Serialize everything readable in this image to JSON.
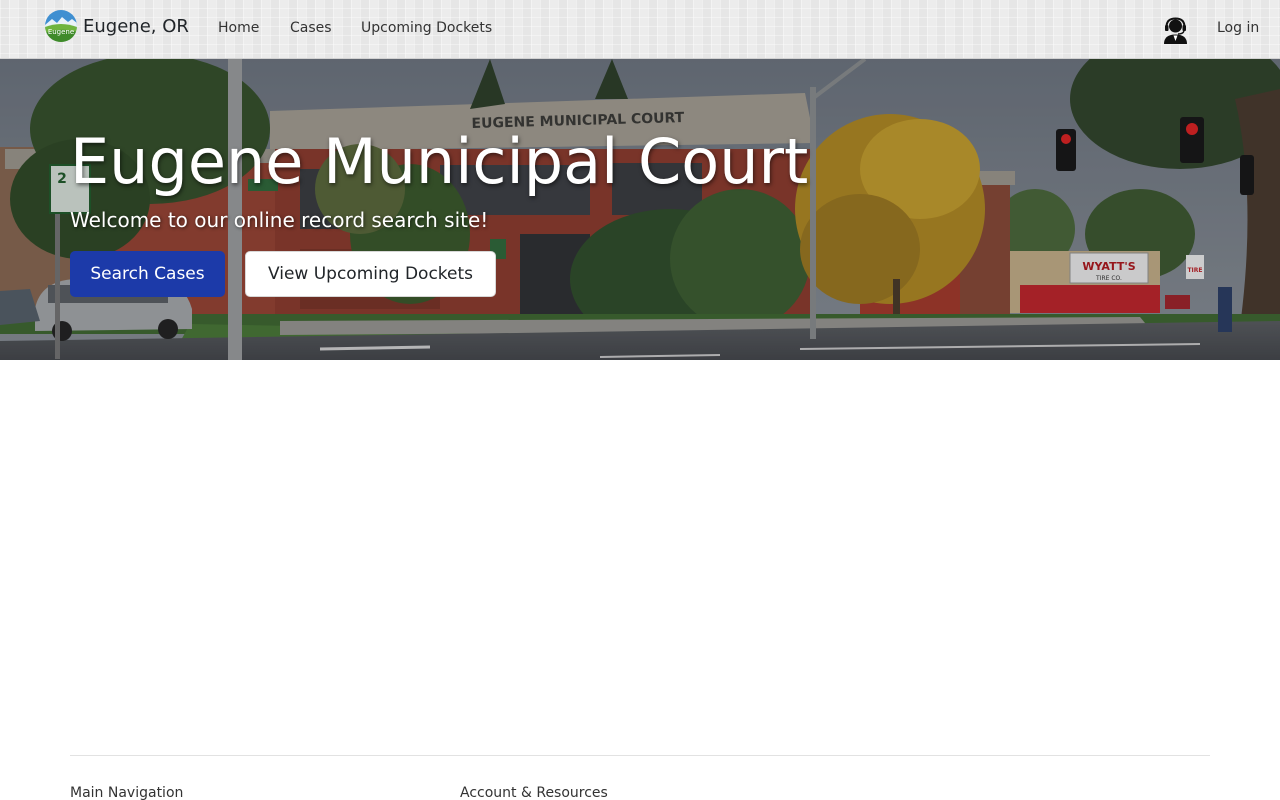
{
  "navbar": {
    "brand_logo_text": "Eugene",
    "brand_name": "Eugene, OR",
    "links": [
      {
        "label": "Home"
      },
      {
        "label": "Cases"
      },
      {
        "label": "Upcoming Dockets"
      }
    ],
    "login_label": "Log in",
    "support_icon": "user-headset-icon"
  },
  "hero": {
    "title": "Eugene Municipal Court",
    "subtitle": "Welcome to our online record search site!",
    "primary_button": "Search Cases",
    "secondary_button": "View Upcoming Dockets",
    "scene": {
      "building_sign": "EUGENE MUNICIPAL COURT",
      "store_sign": "WYATT'S",
      "store_sign_sub": "TIRE CO.",
      "street_sign_number": "2",
      "side_sign": "TIRE"
    }
  },
  "footer": {
    "headings": [
      {
        "label": "Main Navigation"
      },
      {
        "label": "Account & Resources"
      }
    ]
  },
  "colors": {
    "primary": "#1c3aa9",
    "navbar_bg": "#ececec",
    "text": "#212529"
  }
}
